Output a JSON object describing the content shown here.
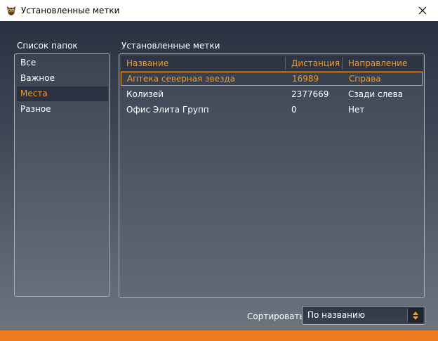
{
  "window": {
    "title": "Установленные метки",
    "icon": "owl-icon",
    "close_icon": "close-icon"
  },
  "folders": {
    "label": "Список папок",
    "items": [
      {
        "label": "Все",
        "selected": false
      },
      {
        "label": "Важное",
        "selected": false
      },
      {
        "label": "Места",
        "selected": true
      },
      {
        "label": "Разное",
        "selected": false
      }
    ]
  },
  "marks": {
    "label": "Установленные метки",
    "columns": [
      "Название",
      "Дистанция",
      "Направление"
    ],
    "rows": [
      {
        "name": "Аптека северная звезда",
        "distance": "16989",
        "direction": "Справа",
        "selected": true
      },
      {
        "name": "Колизей",
        "distance": "2377669",
        "direction": "Сзади слева",
        "selected": false
      },
      {
        "name": "Офис Элита Групп",
        "distance": "0",
        "direction": "Нет",
        "selected": false
      }
    ]
  },
  "sort": {
    "label": "Сортировать:",
    "value": "По названию"
  },
  "colors": {
    "accent": "#f19a2a",
    "bottom_bar": "#f07c1f",
    "selection_bg": "#2b3140"
  }
}
